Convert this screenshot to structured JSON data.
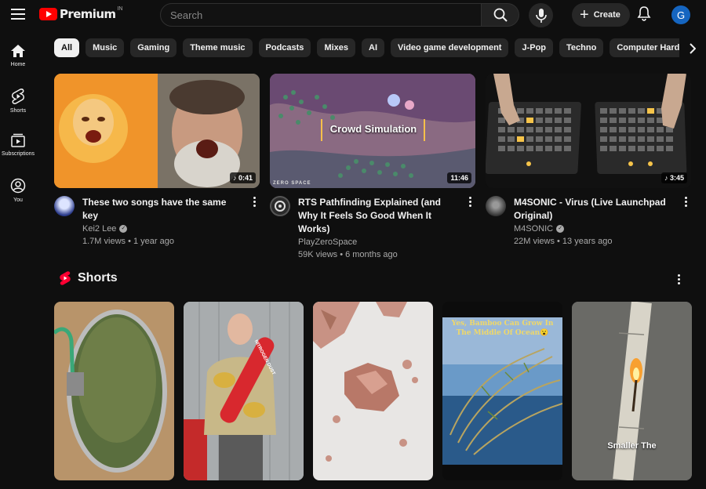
{
  "header": {
    "logo_text": "Premium",
    "region": "IN",
    "search_placeholder": "Search",
    "create_label": "Create",
    "avatar_letter": "G"
  },
  "sidebar": {
    "items": [
      {
        "label": "Home",
        "icon": "home-icon"
      },
      {
        "label": "Shorts",
        "icon": "shorts-icon"
      },
      {
        "label": "Subscriptions",
        "icon": "subscriptions-icon"
      },
      {
        "label": "You",
        "icon": "you-icon"
      }
    ]
  },
  "chips": [
    "All",
    "Music",
    "Gaming",
    "Theme music",
    "Podcasts",
    "Mixes",
    "AI",
    "Video game development",
    "J-Pop",
    "Techno",
    "Computer Hardware"
  ],
  "videos": [
    {
      "title": "These two songs have the same key",
      "channel": "Kei2 Lee",
      "verified": true,
      "stats": "1.7M views • 1 year ago",
      "duration": "♪ 0:41"
    },
    {
      "title": "RTS Pathfinding Explained (and Why It Feels So Good When It Works)",
      "channel": "PlayZeroSpace",
      "verified": false,
      "stats": "59K views • 6 months ago",
      "duration": "11:46",
      "thumb_caption": "Crowd Simulation",
      "thumb_watermark": "ZERO SPACE"
    },
    {
      "title": "M4SONIC - Virus (Live Launchpad Original)",
      "channel": "M4SONIC",
      "verified": true,
      "stats": "22M views • 13 years ago",
      "duration": "♪ 3:45"
    }
  ],
  "shorts": {
    "title": "Shorts",
    "items": [
      {
        "caption": ""
      },
      {
        "caption": "",
        "sign": "NITROGEN DUST"
      },
      {
        "caption": ""
      },
      {
        "caption": "Yes, Bamboo Can Grow In The Middle Of Ocean😮"
      },
      {
        "caption": "Smaller The"
      }
    ]
  },
  "colors": {
    "background": "#0f0f0f",
    "brand_red": "#ff0000",
    "chip_bg": "#272727",
    "avatar_bg": "#1565c0"
  }
}
